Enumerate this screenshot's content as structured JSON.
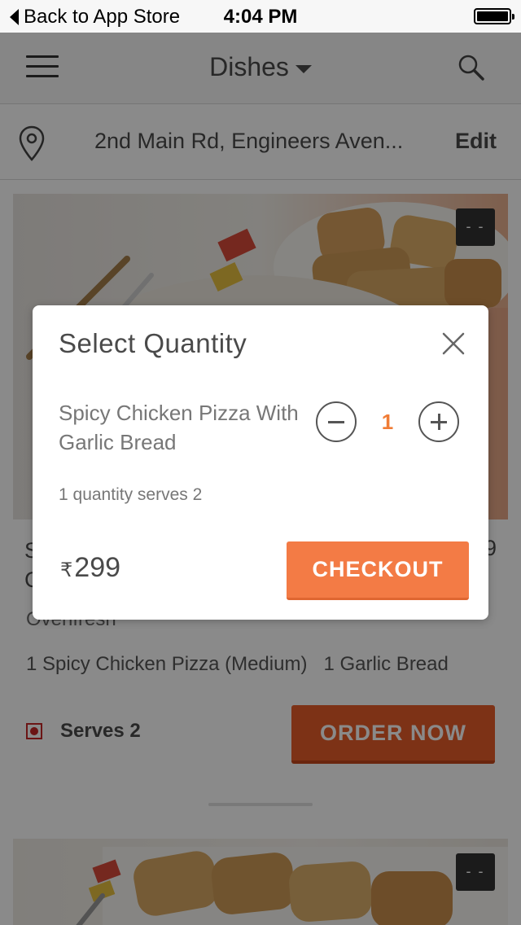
{
  "status_bar": {
    "back_label": "Back to App Store",
    "time": "4:04 PM"
  },
  "nav": {
    "title": "Dishes"
  },
  "location": {
    "address": "2nd Main Rd, Engineers Aven...",
    "edit_label": "Edit"
  },
  "dish_card": {
    "favorite_badge": "- -",
    "title_left": "S\nC",
    "price_partial": "9",
    "restaurant": "Ovenfresh",
    "items": [
      "1 Spicy Chicken Pizza (Medium)",
      "1 Garlic Bread"
    ],
    "serves_label": "Serves 2",
    "order_label": "ORDER NOW"
  },
  "second_card": {
    "favorite_badge": "- -"
  },
  "modal": {
    "title": "Select Quantity",
    "dish_name": "Spicy Chicken Pizza With Garlic Bread",
    "quantity": "1",
    "serves_note": "1 quantity serves 2",
    "currency_symbol": "₹",
    "price": "299",
    "checkout_label": "CHECKOUT"
  },
  "colors": {
    "accent": "#f37b45",
    "order_button": "#e85d2a",
    "quantity_text": "#f07c36",
    "veg_mark": "#c62828"
  }
}
